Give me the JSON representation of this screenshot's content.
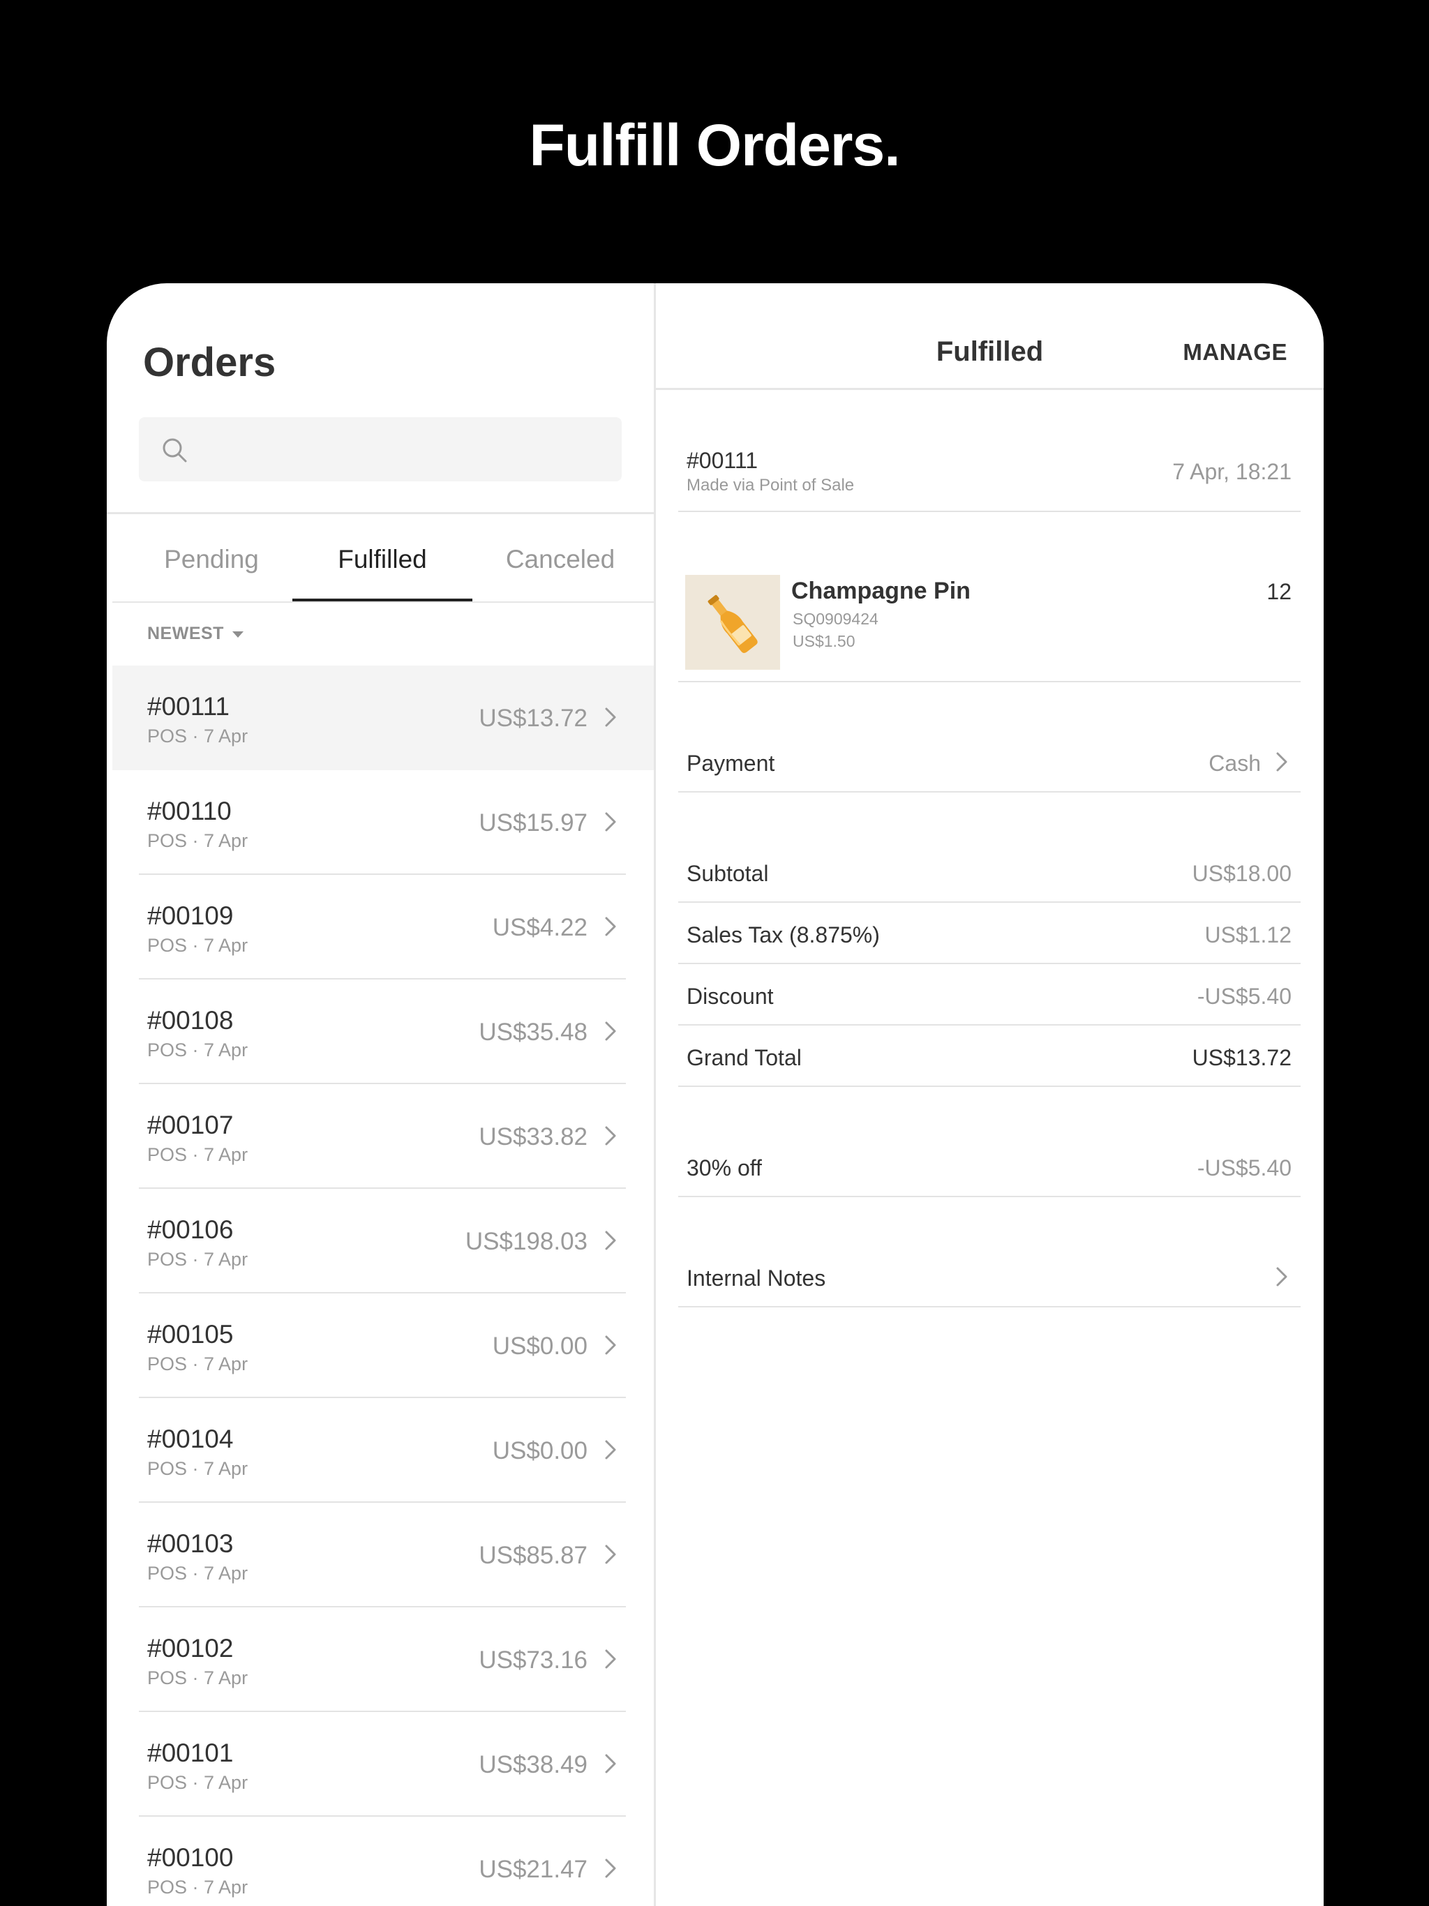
{
  "headline": "Fulfill Orders.",
  "left_pane": {
    "title": "Orders",
    "search": {
      "placeholder": ""
    },
    "tabs": [
      {
        "label": "Pending",
        "active": false
      },
      {
        "label": "Fulfilled",
        "active": true
      },
      {
        "label": "Canceled",
        "active": false
      }
    ],
    "sort_label": "NEWEST",
    "orders": [
      {
        "id": "#00111",
        "sub": "POS · 7 Apr",
        "amount": "US$13.72",
        "selected": true
      },
      {
        "id": "#00110",
        "sub": "POS · 7 Apr",
        "amount": "US$15.97"
      },
      {
        "id": "#00109",
        "sub": "POS · 7 Apr",
        "amount": "US$4.22"
      },
      {
        "id": "#00108",
        "sub": "POS · 7 Apr",
        "amount": "US$35.48"
      },
      {
        "id": "#00107",
        "sub": "POS · 7 Apr",
        "amount": "US$33.82"
      },
      {
        "id": "#00106",
        "sub": "POS · 7 Apr",
        "amount": "US$198.03"
      },
      {
        "id": "#00105",
        "sub": "POS · 7 Apr",
        "amount": "US$0.00"
      },
      {
        "id": "#00104",
        "sub": "POS · 7 Apr",
        "amount": "US$0.00"
      },
      {
        "id": "#00103",
        "sub": "POS · 7 Apr",
        "amount": "US$85.87"
      },
      {
        "id": "#00102",
        "sub": "POS · 7 Apr",
        "amount": "US$73.16"
      },
      {
        "id": "#00101",
        "sub": "POS · 7 Apr",
        "amount": "US$38.49"
      },
      {
        "id": "#00100",
        "sub": "POS · 7 Apr",
        "amount": "US$21.47"
      }
    ]
  },
  "detail": {
    "title": "Fulfilled",
    "manage_label": "MANAGE",
    "order_number": "#00111",
    "order_source": "Made via Point of Sale",
    "order_date": "7 Apr, 18:21",
    "item": {
      "name": "Champagne Pin",
      "sku": "SQ0909424",
      "price": "US$1.50",
      "quantity": "12",
      "icon": "champagne-bottle-icon"
    },
    "payment": {
      "label": "Payment",
      "value": "Cash"
    },
    "subtotal": {
      "label": "Subtotal",
      "value": "US$18.00"
    },
    "tax": {
      "label": "Sales Tax (8.875%)",
      "value": "US$1.12"
    },
    "discount": {
      "label": "Discount",
      "value": "-US$5.40"
    },
    "grand_total": {
      "label": "Grand Total",
      "value": "US$13.72"
    },
    "applied_discount": {
      "label": "30% off",
      "value": "-US$5.40"
    },
    "notes": {
      "label": "Internal Notes"
    }
  },
  "colors": {
    "background": "#000000",
    "surface": "#ffffff",
    "selected_row": "#f4f4f4",
    "text_primary": "#333333",
    "text_secondary": "#999999"
  }
}
